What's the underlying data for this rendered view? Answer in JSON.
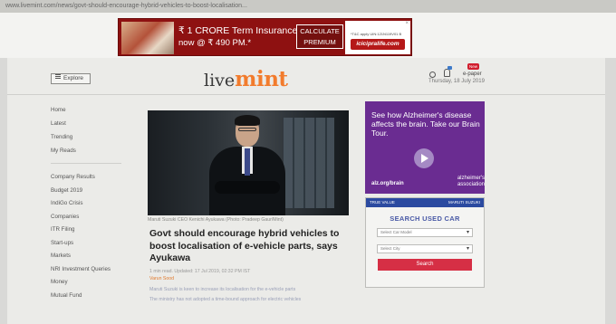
{
  "browser": {
    "url": "www.livemint.com/news/govt-should-encourage-hybrid-vehicles-to-boost-localisation..."
  },
  "ad_top": {
    "line1": "₹ 1 CRORE Term Insurance",
    "line2": "now @ ₹ 490 PM.*",
    "cta_line1": "CALCULATE",
    "cta_line2": "PREMIUM",
    "fineprint": "*T&C apply UIN:121N119V01 B",
    "url": "icicipralife.com",
    "close": "×"
  },
  "header": {
    "explore_label": "Explore",
    "logo_live": "live",
    "logo_mint": "mint",
    "epaper_label": "e-paper",
    "new_badge": "New",
    "date": "Thursday, 18 July 2019"
  },
  "sidenav": {
    "group1": [
      "Home",
      "Latest",
      "Trending",
      "My Reads"
    ],
    "group2": [
      "Company Results",
      "Budget 2019",
      "IndiGo Crisis",
      "Companies",
      "ITR Filing",
      "Start-ups",
      "Markets",
      "NRI Investment Queries",
      "Money",
      "Mutual Fund"
    ]
  },
  "article": {
    "caption": "Maruti Suzuki CEO Kenichi Ayukawa (Photo: Pradeep Gaur/Mint)",
    "headline": "Govt should encourage hybrid vehicles to boost localisation of e-vehicle parts, says Ayukawa",
    "meta": "1 min read. Updated: 17 Jul 2019, 02:32 PM IST",
    "tag": "Varun Sood",
    "bullets": [
      "Maruti Suzuki is keen to increase its localisation for the e-vehicle parts",
      "The ministry has not adopted a time-bound approach for electric vehicles"
    ]
  },
  "ad_alz": {
    "text": "See how Alzheimer's disease affects the brain. Take our Brain Tour.",
    "url": "alz.org/brain",
    "brand": "alzheimer's association"
  },
  "ad_usedcar": {
    "brand_left": "TRUE VALUE",
    "brand_right": "MARUTI SUZUKI",
    "title": "SEARCH USED CAR",
    "select_model": "Select Car Model",
    "select_city": "Select City",
    "button": "Search"
  }
}
